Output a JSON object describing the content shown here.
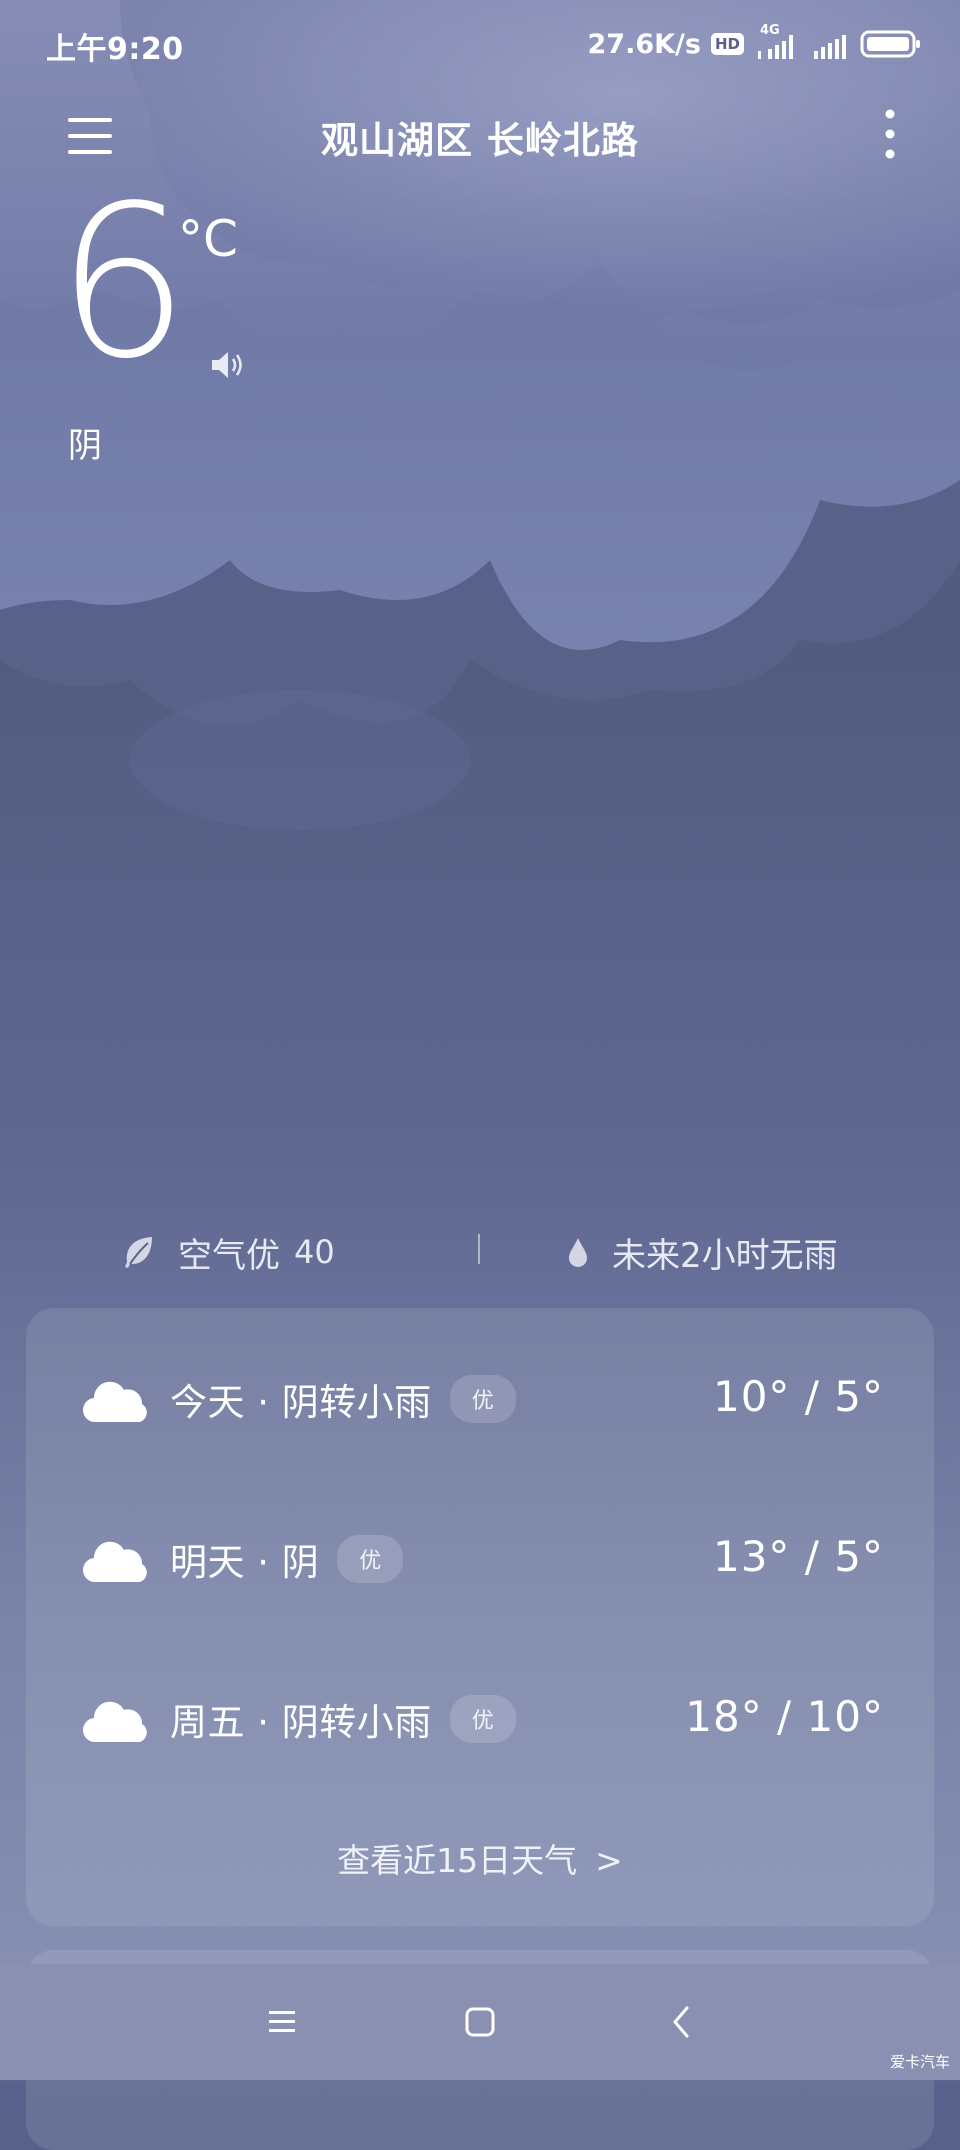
{
  "status_bar": {
    "time": "上午9:20",
    "net_speed": "27.6K/s",
    "hd_badge": "HD",
    "network_type": "4G",
    "icons": [
      "hd-icon",
      "signal-4g-icon",
      "signal-icon",
      "battery-icon"
    ]
  },
  "header": {
    "location": "观山湖区 长岭北路",
    "menu_icon": "menu-icon",
    "more_icon": "more-vertical-icon"
  },
  "current": {
    "temperature": "6",
    "unit": "°C",
    "condition": "阴",
    "speaker_icon": "speaker-icon"
  },
  "info_strip": {
    "aqi_label": "空气优",
    "aqi_value": "40",
    "aqi_icon": "leaf-icon",
    "rain_text": "未来2小时无雨",
    "rain_icon": "raindrop-icon"
  },
  "forecast": [
    {
      "day": "今天 · 阴转小雨",
      "badge": "优",
      "temp": "10° / 5°",
      "icon": "cloud-icon"
    },
    {
      "day": "明天 · 阴",
      "badge": "优",
      "temp": "13° / 5°",
      "icon": "cloud-icon"
    },
    {
      "day": "周五 · 阴转小雨",
      "badge": "优",
      "temp": "18° / 10°",
      "icon": "cloud-icon"
    }
  ],
  "forecast_more": "查看近15日天气",
  "forecast_more_chevron": ">",
  "nav": {
    "icons": [
      "nav-menu-icon",
      "nav-home-icon",
      "nav-back-icon"
    ]
  },
  "watermark": "爱卡汽车",
  "colors": {
    "background": "#59628c",
    "cloud_light": "#7580ac",
    "navbar": "#8990b2"
  }
}
